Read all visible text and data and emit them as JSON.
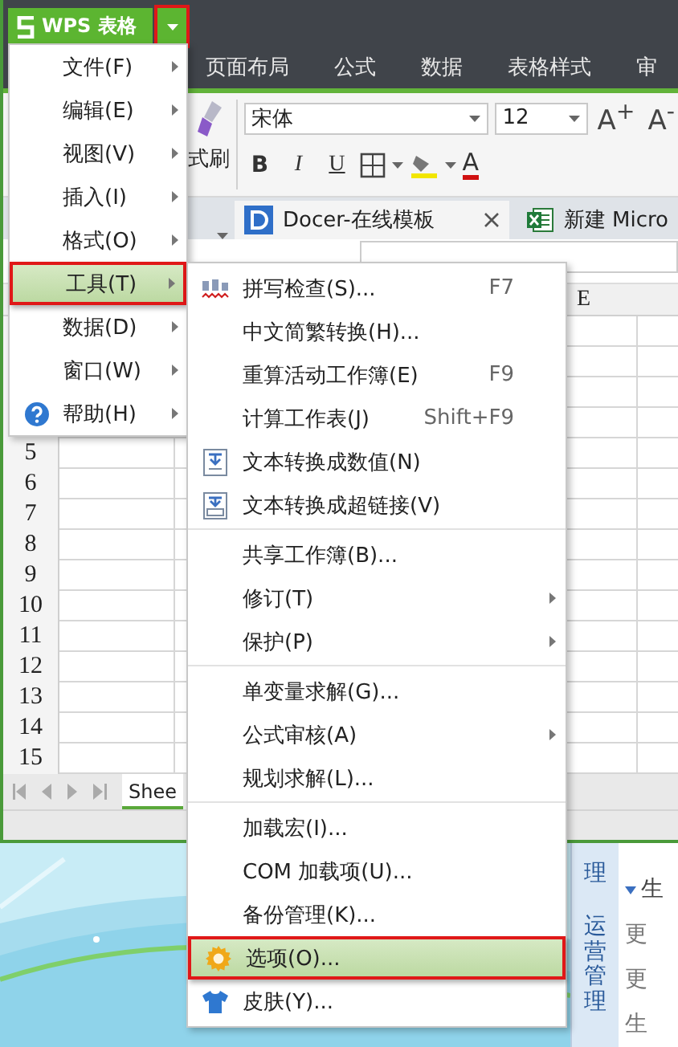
{
  "app_button": {
    "label": "WPS 表格",
    "menu_button_marked": true
  },
  "ribbon_tabs": [
    "页面布局",
    "公式",
    "数据",
    "表格样式",
    "审"
  ],
  "ribbon": {
    "format_painter": "式刷",
    "font_name": "宋体",
    "font_size": "12",
    "size_buttons": [
      "A$^{+}$",
      "A$^{-}$"
    ],
    "style_buttons": [
      "B",
      "I",
      "U"
    ],
    "font_color_button": "A"
  },
  "document_tabs": [
    {
      "label": "Docer-在线模板",
      "closable": true
    },
    {
      "label": "新建 Micro",
      "closable": false
    }
  ],
  "sheet": {
    "column_header": "E",
    "row_numbers": [
      "5",
      "6",
      "7",
      "8",
      "9",
      "10",
      "11",
      "12",
      "13",
      "14",
      "15"
    ],
    "sheet_tab": "Shee"
  },
  "main_menu": [
    {
      "label": "文件(F)",
      "has_submenu": true,
      "selected": false
    },
    {
      "label": "编辑(E)",
      "has_submenu": true,
      "selected": false
    },
    {
      "label": "视图(V)",
      "has_submenu": true,
      "selected": false
    },
    {
      "label": "插入(I)",
      "has_submenu": true,
      "selected": false
    },
    {
      "label": "格式(O)",
      "has_submenu": true,
      "selected": false
    },
    {
      "label": "工具(T)",
      "has_submenu": true,
      "selected": true
    },
    {
      "label": "数据(D)",
      "has_submenu": true,
      "selected": false
    },
    {
      "label": "窗口(W)",
      "has_submenu": true,
      "selected": false
    },
    {
      "label": "帮助(H)",
      "has_submenu": true,
      "selected": false
    }
  ],
  "tools_menu": [
    [
      {
        "label": "拼写检查(S)...",
        "shortcut": "F7",
        "has_submenu": false,
        "selected": false
      },
      {
        "label": "中文简繁转换(H)...",
        "has_submenu": false,
        "selected": false
      },
      {
        "label": "重算活动工作簿(E)",
        "shortcut": "F9",
        "has_submenu": false,
        "selected": false
      },
      {
        "label": "计算工作表(J)",
        "shortcut": "Shift+F9",
        "has_submenu": false,
        "selected": false
      },
      {
        "label": "文本转换成数值(N)",
        "has_submenu": false,
        "selected": false
      },
      {
        "label": "文本转换成超链接(V)",
        "has_submenu": false,
        "selected": false
      }
    ],
    [
      {
        "label": "共享工作簿(B)...",
        "has_submenu": false,
        "selected": false
      },
      {
        "label": "修订(T)",
        "has_submenu": true,
        "selected": false
      },
      {
        "label": "保护(P)",
        "has_submenu": true,
        "selected": false
      }
    ],
    [
      {
        "label": "单变量求解(G)...",
        "has_submenu": false,
        "selected": false
      },
      {
        "label": "公式审核(A)",
        "has_submenu": true,
        "selected": false
      },
      {
        "label": "规划求解(L)...",
        "has_submenu": false,
        "selected": false
      }
    ],
    [
      {
        "label": "加载宏(I)...",
        "has_submenu": false,
        "selected": false
      },
      {
        "label": "COM 加载项(U)...",
        "has_submenu": false,
        "selected": false
      },
      {
        "label": "备份管理(K)...",
        "has_submenu": false,
        "selected": false
      },
      {
        "label": "选项(O)...",
        "has_submenu": false,
        "selected": true
      },
      {
        "label": "皮肤(Y)...",
        "has_submenu": false,
        "selected": false
      }
    ]
  ],
  "side_panel": {
    "strip_texts": [
      "理",
      "运营管理"
    ],
    "items": [
      {
        "label": "生",
        "expander": true
      },
      {
        "label": "更",
        "expander": false
      },
      {
        "label": "更",
        "expander": false
      },
      {
        "label": "生",
        "expander": false
      }
    ]
  }
}
